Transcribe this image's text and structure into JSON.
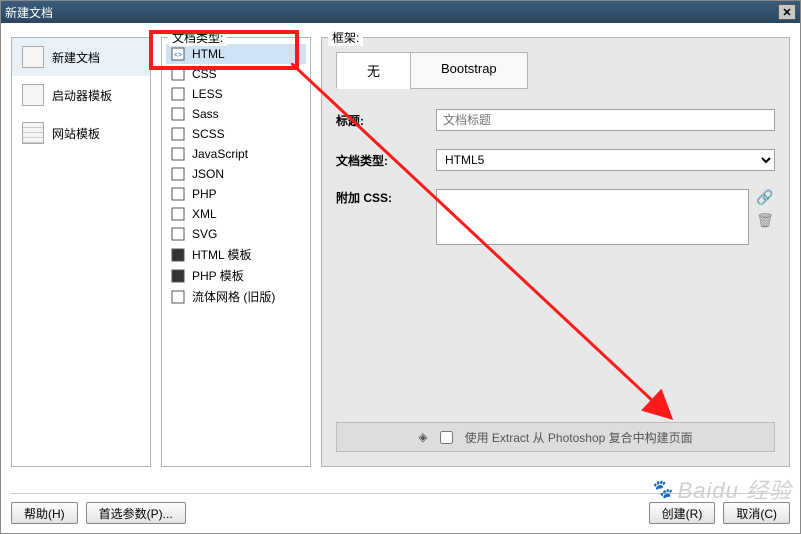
{
  "window": {
    "title": "新建文档"
  },
  "left_panel": {
    "items": [
      {
        "label": "新建文档",
        "selected": true,
        "icon": "doc"
      },
      {
        "label": "启动器模板",
        "selected": false,
        "icon": "tpl"
      },
      {
        "label": "网站模板",
        "selected": false,
        "icon": "grid"
      }
    ]
  },
  "mid_panel": {
    "label": "文档类型:",
    "items": [
      {
        "label": "HTML",
        "selected": true
      },
      {
        "label": "CSS"
      },
      {
        "label": "LESS"
      },
      {
        "label": "Sass"
      },
      {
        "label": "SCSS"
      },
      {
        "label": "JavaScript"
      },
      {
        "label": "JSON"
      },
      {
        "label": "PHP"
      },
      {
        "label": "XML"
      },
      {
        "label": "SVG"
      },
      {
        "label": "HTML 模板"
      },
      {
        "label": "PHP 模板"
      },
      {
        "label": "流体网格 (旧版)"
      }
    ]
  },
  "right_panel": {
    "label": "框架:",
    "tabs": [
      {
        "label": "无",
        "active": true
      },
      {
        "label": "Bootstrap",
        "active": false
      }
    ],
    "rows": {
      "title_label": "标题:",
      "title_placeholder": "文档标题",
      "doctype_label": "文档类型:",
      "doctype_value": "HTML5",
      "css_label": "附加 CSS:"
    },
    "extract_text": "使用 Extract 从 Photoshop 复合中构建页面"
  },
  "footer": {
    "help": "帮助(H)",
    "prefs": "首选参数(P)...",
    "create": "创建(R)",
    "cancel": "取消(C)"
  },
  "watermark": "Baidu 经验"
}
